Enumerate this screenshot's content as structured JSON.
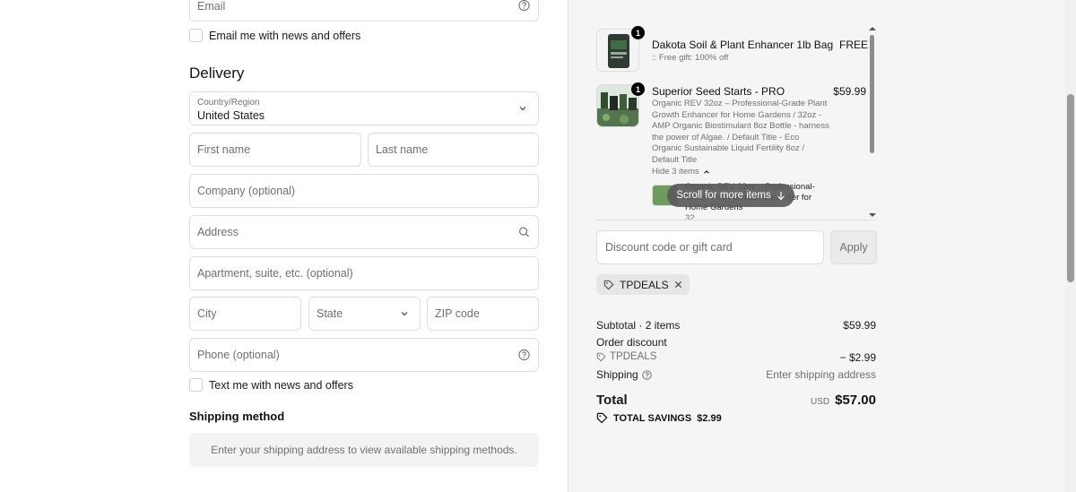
{
  "contact": {
    "email_placeholder": "Email",
    "email_news_label": "Email me with news and offers"
  },
  "delivery": {
    "title": "Delivery",
    "country_label": "Country/Region",
    "country_value": "United States",
    "first_name_placeholder": "First name",
    "last_name_placeholder": "Last name",
    "company_placeholder": "Company (optional)",
    "address_placeholder": "Address",
    "apartment_placeholder": "Apartment, suite, etc. (optional)",
    "city_placeholder": "City",
    "state_placeholder": "State",
    "zip_placeholder": "ZIP code",
    "phone_placeholder": "Phone (optional)",
    "text_news_label": "Text me with news and offers"
  },
  "shipping_method": {
    "title": "Shipping method",
    "message": "Enter your shipping address to view available shipping methods."
  },
  "cart": {
    "items": [
      {
        "quantity": "1",
        "title": "Dakota Soil & Plant Enhancer 1lb Bag",
        "subtitle": ":: Free gift: 100% off",
        "price": "FREE"
      },
      {
        "quantity": "1",
        "title": "Superior Seed Starts - PRO",
        "subtitle_lines": [
          "Organic REV 32oz – Professional-Grade Plant",
          "Growth Enhancer for Home Gardens / 32oz -",
          "AMP Organic Biostimulant 8oz Bottle - harness",
          "the power of Algae. / Default Title - Eco",
          "Organic Sustainable Liquid Fertility 8oz /",
          "Default Title"
        ],
        "price": "$59.99",
        "toggle_label": "Hide 3 items",
        "sub_item_lines": [
          "Organic REV 32oz – Professional-",
          "Grade Plant Growth Enhancer for",
          "Home Gardens",
          "32"
        ]
      }
    ],
    "scroll_hint": "Scroll for more items"
  },
  "discount": {
    "placeholder": "Discount code or gift card",
    "apply_label": "Apply",
    "applied_code": "TPDEALS"
  },
  "summary": {
    "subtotal_label": "Subtotal · 2 items",
    "subtotal_value": "$59.99",
    "order_discount_label": "Order discount",
    "discount_code": "TPDEALS",
    "discount_value": "− $2.99",
    "shipping_label": "Shipping",
    "shipping_value": "Enter shipping address",
    "total_label": "Total",
    "currency": "USD",
    "total_value": "$57.00",
    "savings_label": "TOTAL SAVINGS",
    "savings_value": "$2.99"
  },
  "colors": {
    "panel_bg": "#f5f5f5",
    "border": "#dedede",
    "muted_text": "#707070",
    "chip_bg": "#e6e6e6"
  }
}
